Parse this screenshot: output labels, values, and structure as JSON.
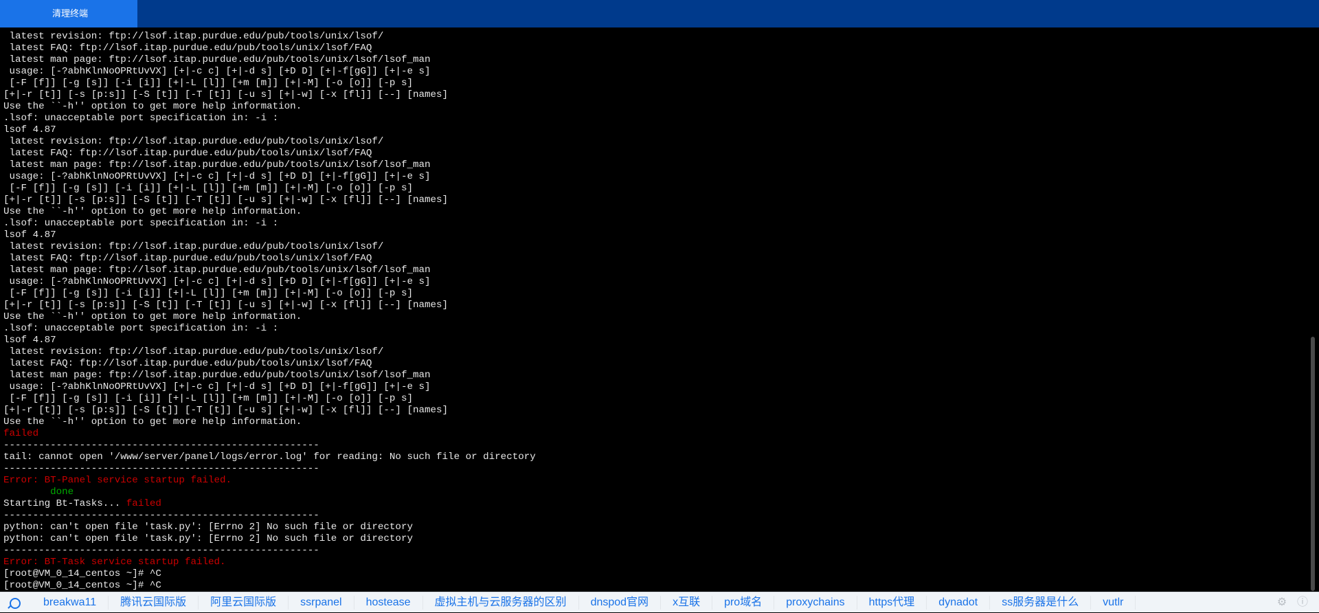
{
  "header": {
    "tab_label": "清理终端"
  },
  "terminal": {
    "lines": [
      {
        "t": " latest revision: ftp://lsof.itap.purdue.edu/pub/tools/unix/lsof/"
      },
      {
        "t": " latest FAQ: ftp://lsof.itap.purdue.edu/pub/tools/unix/lsof/FAQ"
      },
      {
        "t": " latest man page: ftp://lsof.itap.purdue.edu/pub/tools/unix/lsof/lsof_man"
      },
      {
        "t": " usage: [-?abhKlnNoOPRtUvVX] [+|-c c] [+|-d s] [+D D] [+|-f[gG]] [+|-e s]"
      },
      {
        "t": " [-F [f]] [-g [s]] [-i [i]] [+|-L [l]] [+m [m]] [+|-M] [-o [o]] [-p s]"
      },
      {
        "t": "[+|-r [t]] [-s [p:s]] [-S [t]] [-T [t]] [-u s] [+|-w] [-x [fl]] [--] [names]"
      },
      {
        "t": "Use the ``-h'' option to get more help information."
      },
      {
        "t": ".lsof: unacceptable port specification in: -i :"
      },
      {
        "t": "lsof 4.87"
      },
      {
        "t": " latest revision: ftp://lsof.itap.purdue.edu/pub/tools/unix/lsof/"
      },
      {
        "t": " latest FAQ: ftp://lsof.itap.purdue.edu/pub/tools/unix/lsof/FAQ"
      },
      {
        "t": " latest man page: ftp://lsof.itap.purdue.edu/pub/tools/unix/lsof/lsof_man"
      },
      {
        "t": " usage: [-?abhKlnNoOPRtUvVX] [+|-c c] [+|-d s] [+D D] [+|-f[gG]] [+|-e s]"
      },
      {
        "t": " [-F [f]] [-g [s]] [-i [i]] [+|-L [l]] [+m [m]] [+|-M] [-o [o]] [-p s]"
      },
      {
        "t": "[+|-r [t]] [-s [p:s]] [-S [t]] [-T [t]] [-u s] [+|-w] [-x [fl]] [--] [names]"
      },
      {
        "t": "Use the ``-h'' option to get more help information."
      },
      {
        "t": ".lsof: unacceptable port specification in: -i :"
      },
      {
        "t": "lsof 4.87"
      },
      {
        "t": " latest revision: ftp://lsof.itap.purdue.edu/pub/tools/unix/lsof/"
      },
      {
        "t": " latest FAQ: ftp://lsof.itap.purdue.edu/pub/tools/unix/lsof/FAQ"
      },
      {
        "t": " latest man page: ftp://lsof.itap.purdue.edu/pub/tools/unix/lsof/lsof_man"
      },
      {
        "t": " usage: [-?abhKlnNoOPRtUvVX] [+|-c c] [+|-d s] [+D D] [+|-f[gG]] [+|-e s]"
      },
      {
        "t": " [-F [f]] [-g [s]] [-i [i]] [+|-L [l]] [+m [m]] [+|-M] [-o [o]] [-p s]"
      },
      {
        "t": "[+|-r [t]] [-s [p:s]] [-S [t]] [-T [t]] [-u s] [+|-w] [-x [fl]] [--] [names]"
      },
      {
        "t": "Use the ``-h'' option to get more help information."
      },
      {
        "t": ".lsof: unacceptable port specification in: -i :"
      },
      {
        "t": "lsof 4.87"
      },
      {
        "t": " latest revision: ftp://lsof.itap.purdue.edu/pub/tools/unix/lsof/"
      },
      {
        "t": " latest FAQ: ftp://lsof.itap.purdue.edu/pub/tools/unix/lsof/FAQ"
      },
      {
        "t": " latest man page: ftp://lsof.itap.purdue.edu/pub/tools/unix/lsof/lsof_man"
      },
      {
        "t": " usage: [-?abhKlnNoOPRtUvVX] [+|-c c] [+|-d s] [+D D] [+|-f[gG]] [+|-e s]"
      },
      {
        "t": " [-F [f]] [-g [s]] [-i [i]] [+|-L [l]] [+m [m]] [+|-M] [-o [o]] [-p s]"
      },
      {
        "t": "[+|-r [t]] [-s [p:s]] [-S [t]] [-T [t]] [-u s] [+|-w] [-x [fl]] [--] [names]"
      },
      {
        "t": "Use the ``-h'' option to get more help information."
      },
      {
        "t": "failed",
        "c": "red"
      },
      {
        "t": "------------------------------------------------------"
      },
      {
        "t": "tail: cannot open '/www/server/panel/logs/error.log' for reading: No such file or directory"
      },
      {
        "t": "------------------------------------------------------"
      },
      {
        "t": "Error: BT-Panel service startup failed.",
        "c": "red"
      },
      {
        "t": "        done",
        "c": "green"
      },
      {
        "segs": [
          {
            "t": "Starting Bt-Tasks... "
          },
          {
            "t": "failed",
            "c": "red"
          }
        ]
      },
      {
        "t": "------------------------------------------------------"
      },
      {
        "t": "python: can't open file 'task.py': [Errno 2] No such file or directory"
      },
      {
        "t": "python: can't open file 'task.py': [Errno 2] No such file or directory"
      },
      {
        "t": "------------------------------------------------------"
      },
      {
        "t": "Error: BT-Task service startup failed.",
        "c": "red"
      },
      {
        "t": "[root@VM_0_14_centos ~]# ^C"
      },
      {
        "t": "[root@VM_0_14_centos ~]# ^C"
      }
    ]
  },
  "bookmarks": [
    "breakwa11",
    "腾讯云国际版",
    "阿里云国际版",
    "ssrpanel",
    "hostease",
    "虚拟主机与云服务器的区别",
    "dnspod官网",
    "x互联",
    "pro域名",
    "proxychains",
    "https代理",
    "dynadot",
    "ss服务器是什么",
    "vutlr"
  ],
  "icons": {
    "search": "search-icon",
    "settings": "gear-icon",
    "info": "info-icon"
  },
  "colors": {
    "topbar": "#003a8c",
    "active_tab": "#1a73e8",
    "terminal_bg": "#000000",
    "terminal_text": "#e8e8e8",
    "error_red": "#cc0000",
    "ok_green": "#00aa00",
    "link_blue": "#1a73e8"
  }
}
